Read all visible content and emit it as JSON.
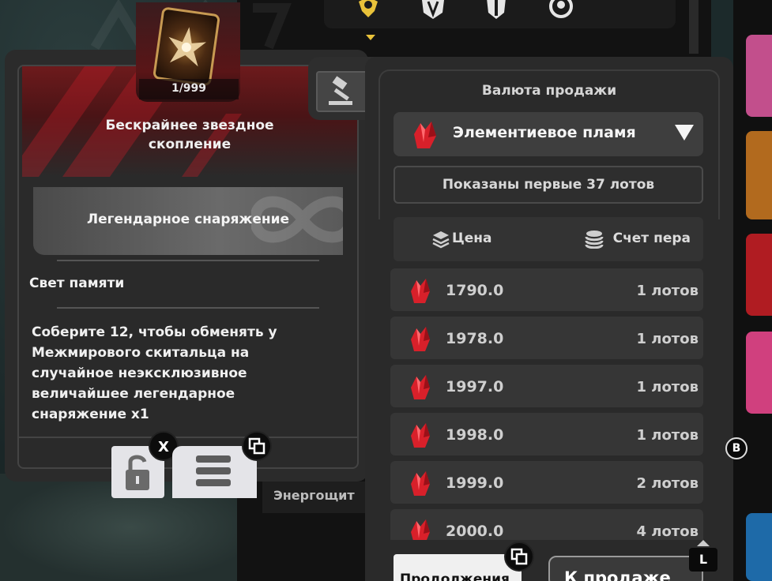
{
  "item": {
    "quantity": "1/999",
    "name": "Бескрайнее звездное скопление",
    "rarity": "Легендарное снаряжение",
    "section_title": "Свет памяти",
    "description": "Соберите 12, чтобы обменять у Межмирового скитальца на случайное неэксклюзивное величайшее легендарное снаряжение x1"
  },
  "badges": {
    "lock_key": "X",
    "menu_key_icon": "copy-icon",
    "right_key": "B",
    "bottom_key": "L"
  },
  "sale": {
    "currency_title": "Валюта продажи",
    "currency_selected": "Элементиевое пламя",
    "shown_info": "Показаны первые 37 лотов",
    "col_price": "Цена",
    "col_pen": "Счет пера",
    "lots": [
      {
        "price": "1790.0",
        "count": "1 лотов"
      },
      {
        "price": "1978.0",
        "count": "1 лотов"
      },
      {
        "price": "1997.0",
        "count": "1 лотов"
      },
      {
        "price": "1998.0",
        "count": "1 лотов"
      },
      {
        "price": "1999.0",
        "count": "2 лотов"
      },
      {
        "price": "2000.0",
        "count": "4 лотов"
      }
    ]
  },
  "buttons": {
    "left_bottom": "Продолжения",
    "right_bottom": "К продаже"
  },
  "side": {
    "energy_label": "Энергощит"
  },
  "colors": {
    "gem_red": "#d8202a",
    "panel": "#2a2a2a",
    "row": "#363636",
    "legendary_red": "#6d1a1c"
  }
}
